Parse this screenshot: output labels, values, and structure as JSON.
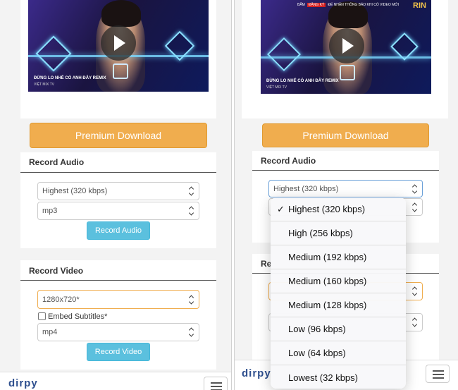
{
  "left_pane": {
    "video": {
      "song_title": "ĐỪNG LO NHÉ CÓ ANH ĐÂY REMIX",
      "channel": "VIỆT MIX TV"
    },
    "premium_button": "Premium Download",
    "record_audio": {
      "heading": "Record Audio",
      "quality_select": "Highest (320 kbps)",
      "format_select": "mp3",
      "button": "Record Audio"
    },
    "record_video": {
      "heading": "Record Video",
      "resolution_select": "1280x720*",
      "embed_subtitles_label": "Embed Subtitles*",
      "embed_subtitles_checked": false,
      "format_select": "mp4",
      "button": "Record Video"
    },
    "footer": {
      "brand": "dirpy"
    }
  },
  "right_pane": {
    "video": {
      "top_text_left": "BẤM",
      "top_badge": "ĐĂNG KÝ",
      "top_text_right": "ĐỂ NHẬN THÔNG BÁO KHI CÓ VIDEO MỚI",
      "corner_logo": "RIN",
      "song_title": "ĐỪNG LO NHÉ CÓ ANH ĐÂY REMIX",
      "channel": "VIỆT MIX TV"
    },
    "premium_button": "Premium Download",
    "record_audio": {
      "heading": "Record Audio",
      "quality_select": "Highest (320 kbps)"
    },
    "record_video_heading_partial": "Re",
    "footer": {
      "brand": "dirpy"
    },
    "dropdown": {
      "selected_index": 0,
      "options": [
        "Highest (320 kbps)",
        "High (256 kbps)",
        "Medium (192 kbps)",
        "Medium (160 kbps)",
        "Medium (128 kbps)",
        "Low (96 kbps)",
        "Low (64 kbps)",
        "Lowest (32 kbps)"
      ],
      "check_mark": "✓"
    }
  },
  "colors": {
    "premium": "#f0ad4e",
    "info_button": "#5bc0de",
    "brand": "#2e4f8e",
    "video_glow": "#7ad8ff"
  }
}
